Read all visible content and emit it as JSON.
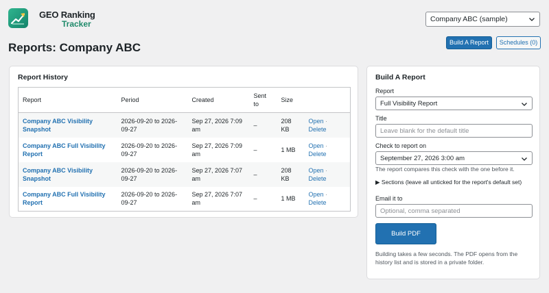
{
  "brand": {
    "name_line1": "GEO Ranking",
    "name_line2": "Tracker"
  },
  "header": {
    "company_selected": "Company ABC (sample)",
    "page_title": "Reports: Company ABC",
    "build_button": "Build A Report",
    "schedules_button": "Schedules (0)"
  },
  "history": {
    "title": "Report History",
    "columns": [
      "Report",
      "Period",
      "Created",
      "Sent to",
      "Size"
    ],
    "rows": [
      {
        "report": "Company ABC Visibility Snapshot",
        "period": "2026-09-20 to 2026-09-27",
        "created": "Sep 27, 2026 7:09 am",
        "sent": "–",
        "size": "208 KB",
        "open": "Open",
        "delete": "Delete"
      },
      {
        "report": "Company ABC Full Visibility Report",
        "period": "2026-09-20 to 2026-09-27",
        "created": "Sep 27, 2026 7:09 am",
        "sent": "–",
        "size": "1 MB",
        "open": "Open",
        "delete": "Delete"
      },
      {
        "report": "Company ABC Visibility Snapshot",
        "period": "2026-09-20 to 2026-09-27",
        "created": "Sep 27, 2026 7:07 am",
        "sent": "–",
        "size": "208 KB",
        "open": "Open",
        "delete": "Delete"
      },
      {
        "report": "Company ABC Full Visibility Report",
        "period": "2026-09-20 to 2026-09-27",
        "created": "Sep 27, 2026 7:07 am",
        "sent": "–",
        "size": "1 MB",
        "open": "Open",
        "delete": "Delete"
      }
    ],
    "action_separator": "·"
  },
  "build": {
    "title": "Build A Report",
    "report_label": "Report",
    "report_value": "Full Visibility Report",
    "title_label": "Title",
    "title_placeholder": "Leave blank for the default title",
    "check_label": "Check to report on",
    "check_value": "September 27, 2026 3:00 am",
    "check_help": "The report compares this check with the one before it.",
    "sections_label": "▶ Sections (leave all unticked for the report's default set)",
    "email_label": "Email it to",
    "email_placeholder": "Optional, comma separated",
    "build_button": "Build PDF",
    "footer_help": "Building takes a few seconds. The PDF opens from the history list and is stored in a private folder."
  },
  "colors": {
    "accent": "#2271b1",
    "brand": "#1f8a6a",
    "background": "#f0f0f1"
  },
  "icons": {
    "logo": "trend-chart-icon",
    "dropdown": "chevron-down-icon"
  }
}
